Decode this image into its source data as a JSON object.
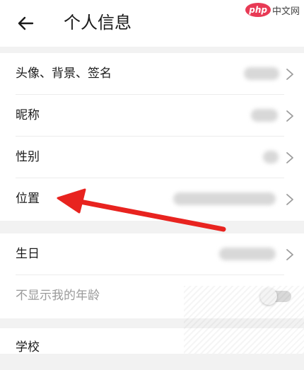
{
  "header": {
    "title": "个人信息",
    "back_icon": "arrow-left-icon",
    "watermark": {
      "php": "php",
      "text": "中文网"
    }
  },
  "groups": [
    {
      "rows": [
        {
          "label": "头像、背景、签名",
          "chevron": "chevron-right-icon"
        },
        {
          "label": "昵称",
          "chevron": "chevron-right-icon"
        },
        {
          "label": "性别",
          "chevron": "chevron-right-icon"
        },
        {
          "label": "位置",
          "chevron": "chevron-right-icon"
        }
      ]
    },
    {
      "rows": [
        {
          "label": "生日",
          "chevron": "chevron-right-icon"
        },
        {
          "label": "不显示我的年龄",
          "toggle": false
        }
      ]
    },
    {
      "rows": [
        {
          "label": "学校"
        }
      ]
    }
  ],
  "annotation": {
    "arrow_color": "#e8231f"
  },
  "colors": {
    "background": "#f2f2f2",
    "surface": "#ffffff",
    "muted_text": "#9a9a9a"
  }
}
